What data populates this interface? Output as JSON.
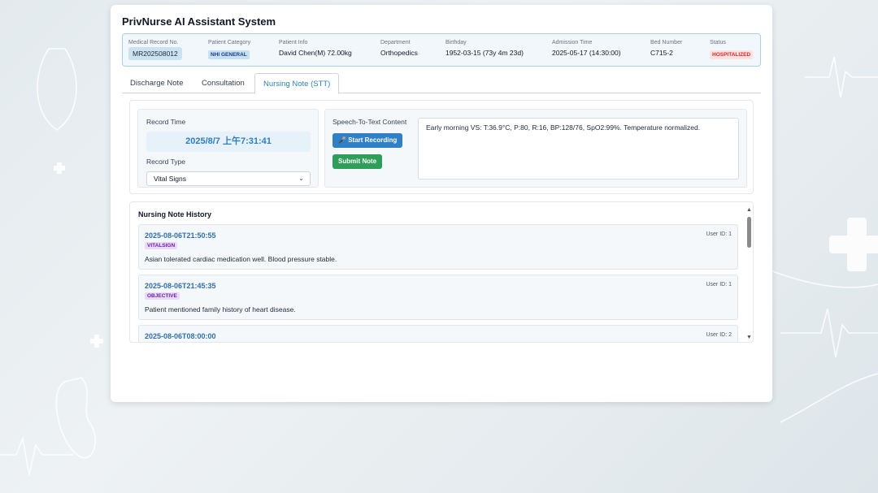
{
  "app": {
    "title": "PrivNurse AI Assistant System"
  },
  "patient": {
    "mrn_label": "Medical Record No.",
    "mrn": "MR202508012",
    "category_label": "Patient Category",
    "category": "NHI GENERAL",
    "info_label": "Patient Info",
    "info": "David Chen(M) 72.00kg",
    "dept_label": "Department",
    "dept": "Orthopedics",
    "birthday_label": "Birthday",
    "birthday": "1952-03-15 (73y 4m 23d)",
    "admission_label": "Admission Time",
    "admission": "2025-05-17 (14:30:00)",
    "bed_label": "Bed Number",
    "bed": "C715-2",
    "status_label": "Status",
    "status": "HOSPITALIZED"
  },
  "tabs": [
    {
      "label": "Discharge Note"
    },
    {
      "label": "Consultation"
    },
    {
      "label": "Nursing Note (STT)"
    }
  ],
  "record": {
    "time_label": "Record Time",
    "time_value": "2025/8/7 上午7:31:41",
    "type_label": "Record Type",
    "type_value": "Vital Signs"
  },
  "stt": {
    "label": "Speech-To-Text Content",
    "record_button": "Start Recording",
    "submit_button": "Submit Note",
    "content": "Early morning VS: T:36.9°C, P:80, R:16, BP:128/76, SpO2:99%. Temperature normalized."
  },
  "history": {
    "title": "Nursing Note History",
    "entries": [
      {
        "time": "2025-08-06T21:50:55",
        "user": "User ID: 1",
        "tag": "VITALSIGN",
        "text": "Asian tolerated cardiac medication well. Blood pressure stable."
      },
      {
        "time": "2025-08-06T21:45:35",
        "user": "User ID: 1",
        "tag": "OBJECTIVE",
        "text": "Patient mentioned family history of heart disease."
      },
      {
        "time": "2025-08-06T08:00:00",
        "user": "User ID: 2",
        "tag": "",
        "text": ""
      }
    ]
  },
  "colors": {
    "accent": "#2f7fbf",
    "record_button": "#2f80c6",
    "submit_button": "#2f9e5a",
    "status_badge": "#dc2626",
    "tag_badge": "#6b21a8"
  }
}
